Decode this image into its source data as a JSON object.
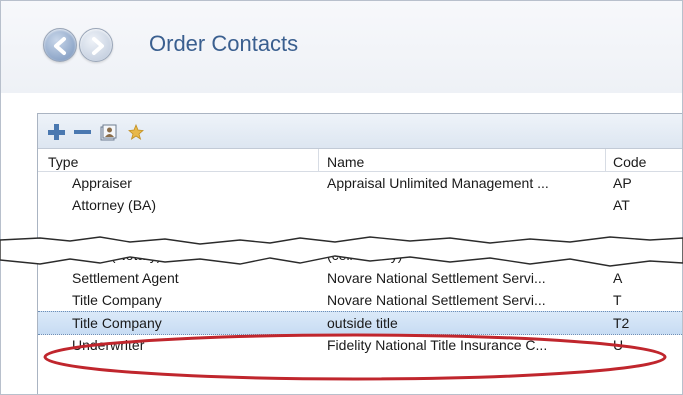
{
  "window": {
    "title": "Order Contacts"
  },
  "icons": {
    "back": "back-arrow-icon",
    "forward": "forward-arrow-icon",
    "add": "plus-icon",
    "remove": "minus-icon",
    "address_book": "address-book-icon",
    "favorite": "star-icon"
  },
  "colors": {
    "title": "#3a5f8f",
    "selection": "#c7dcf3",
    "annotation": "#c0262d",
    "toolbar_icon": "#4a78b0",
    "star": "#e8b84a"
  },
  "table": {
    "columns": [
      "Type",
      "Name",
      "Code"
    ],
    "rows": [
      {
        "type": "Appraiser",
        "name": "Appraisal Unlimited Management ...",
        "code": "AP"
      },
      {
        "type": "Attorney (BA)",
        "name": "",
        "code": "AT"
      },
      {
        "type": "Other (Notary)",
        "name": "(cell Notary)",
        "code": ""
      },
      {
        "type": "Settlement Agent",
        "name": "Novare National Settlement Servi...",
        "code": "A"
      },
      {
        "type": "Title Company",
        "name": "Novare National Settlement Servi...",
        "code": "T"
      },
      {
        "type": "Title Company",
        "name": "outside title",
        "code": "T2",
        "selected": true
      },
      {
        "type": "Underwriter",
        "name": "Fidelity National Title Insurance C...",
        "code": "U"
      }
    ]
  }
}
